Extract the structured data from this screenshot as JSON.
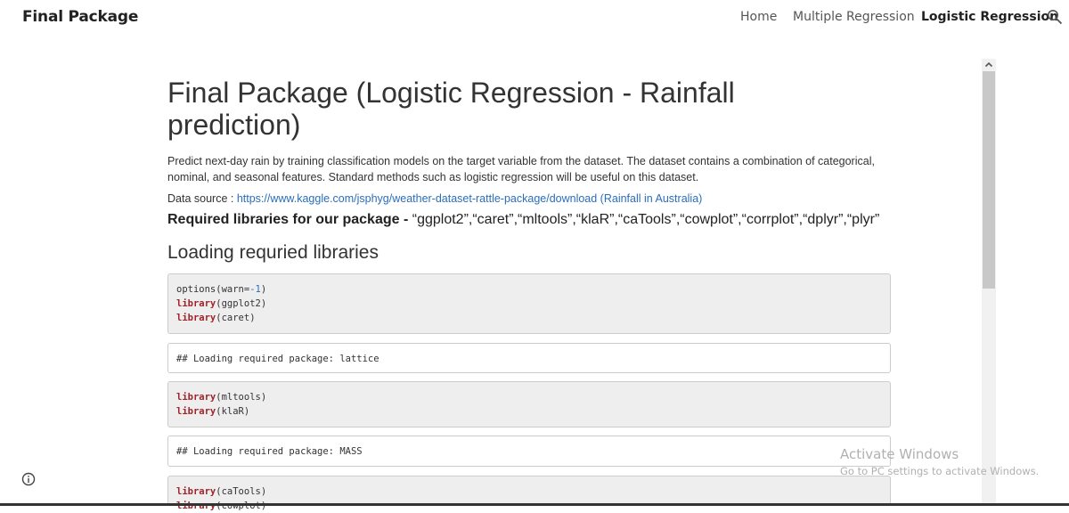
{
  "header": {
    "site_title": "Final Package",
    "nav": [
      {
        "label": "Home",
        "active": false
      },
      {
        "label": "Multiple Regression",
        "active": false
      },
      {
        "label": "Logistic Regression",
        "active": true
      }
    ]
  },
  "page": {
    "title": "Final Package (Logistic Regression - Rainfall prediction)",
    "description": "Predict next-day rain by training classification models on the target variable from the dataset. The dataset contains a combination of categorical, nominal, and seasonal features. Standard methods such as logistic regression will be useful on this dataset.",
    "source_label": "Data source : ",
    "source_link": "https://www.kaggle.com/jsphyg/weather-dataset-rattle-package/download (Rainfall in Australia)",
    "libs_label": "Required libraries for our package - ",
    "libs_list": "“ggplot2”,“caret”,“mltools”,“klaR”,“caTools”,“cowplot”,“corrplot”,“dplyr”,“plyr”",
    "section_heading": "Loading requried libraries"
  },
  "code": {
    "block1": {
      "line1_fn": "options(warn=",
      "line1_num": "-1",
      "line1_end": ")",
      "line2_kw": "library",
      "line2_arg": "(ggplot2)",
      "line3_kw": "library",
      "line3_arg": "(caret)"
    },
    "out1": "## Loading required package: lattice",
    "block2": {
      "line1_kw": "library",
      "line1_arg": "(mltools)",
      "line2_kw": "library",
      "line2_arg": "(klaR)"
    },
    "out2": "## Loading required package: MASS",
    "block3": {
      "line1_kw": "library",
      "line1_arg": "(caTools)",
      "line2_kw": "library",
      "line2_arg": "(cowplot)"
    }
  },
  "watermark": {
    "line1": "Activate Windows",
    "line2": "Go to PC settings to activate Windows."
  }
}
